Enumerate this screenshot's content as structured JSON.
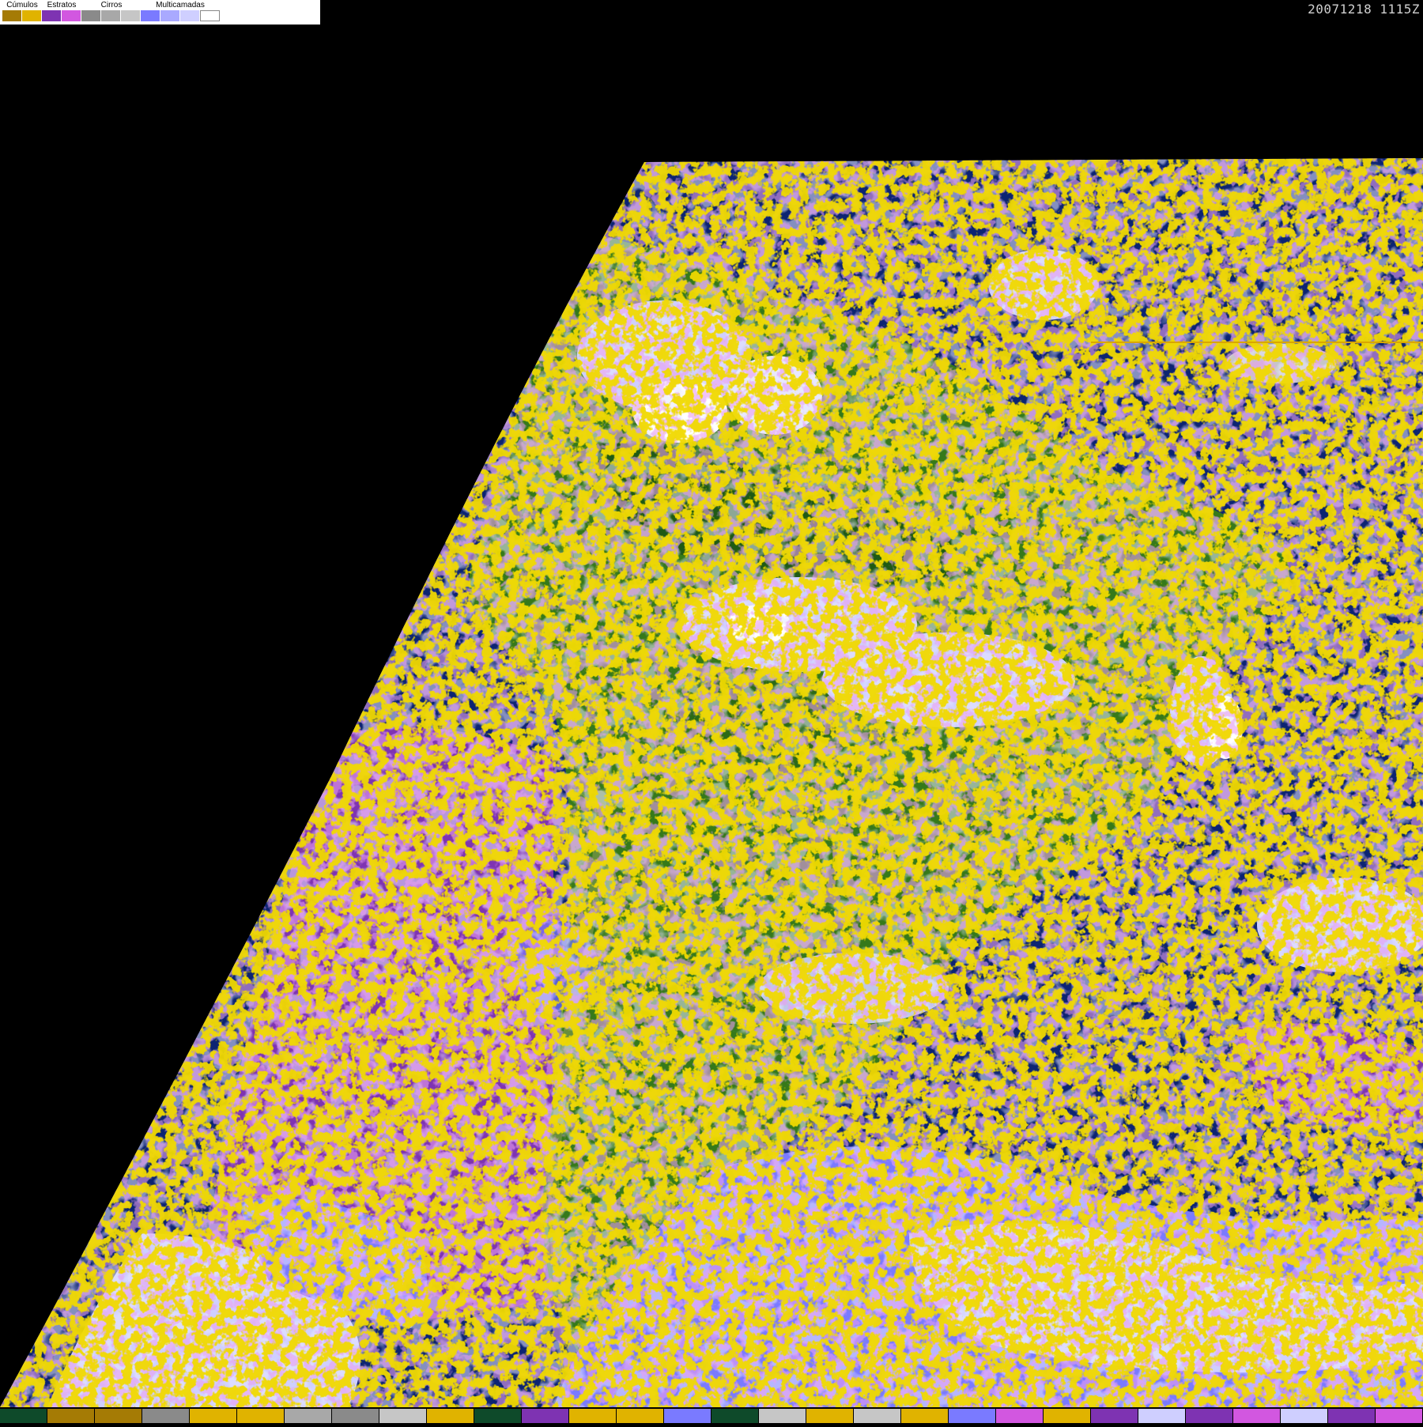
{
  "timestamp": "20071218 1115Z",
  "legend": {
    "groups": [
      {
        "label": "Cúmulos",
        "colors": [
          "#a57b05",
          "#e0b300"
        ]
      },
      {
        "label": "Estratos",
        "colors": [
          "#7e33b2",
          "#d257e0"
        ]
      },
      {
        "label": "Cirros",
        "colors": [
          "#8a8a8a",
          "#a8a8a8",
          "#c6c6c6"
        ]
      },
      {
        "label": "Multicamadas",
        "colors": [
          "#7a7aff",
          "#a9a9ff",
          "#cfcfff",
          "#ffffff"
        ]
      }
    ]
  },
  "palette": {
    "background": "#000000",
    "ocean": "#0c2472",
    "land": "#35791a",
    "land_dark": "#1f5a14",
    "stratus": "#7e33b2",
    "stratus_light": "#d257e0",
    "cumulus": "#e0b300",
    "cumulus_dark": "#a57b05",
    "cirrus": "#c6c6c6",
    "multilayer": "#7a7aff",
    "multilayer_light": "#cfcfff"
  },
  "bottom_strip": [
    "#0e4a2a",
    "#a57b05",
    "#a57b05",
    "#8a8a8a",
    "#e0b300",
    "#e0b300",
    "#a8a8a8",
    "#8a8a8a",
    "#c6c6c6",
    "#e0b300",
    "#0e4a2a",
    "#7e33b2",
    "#e0b300",
    "#e0b300",
    "#7a7aff",
    "#0e4a2a",
    "#c6c6c6",
    "#e0b300",
    "#c6c6c6",
    "#e0b300",
    "#7a7aff",
    "#d257e0",
    "#e0b300",
    "#7e33b2",
    "#cfcfff",
    "#7e33b2",
    "#d257e0",
    "#cfcfff",
    "#7e33b2",
    "#d257e0"
  ]
}
